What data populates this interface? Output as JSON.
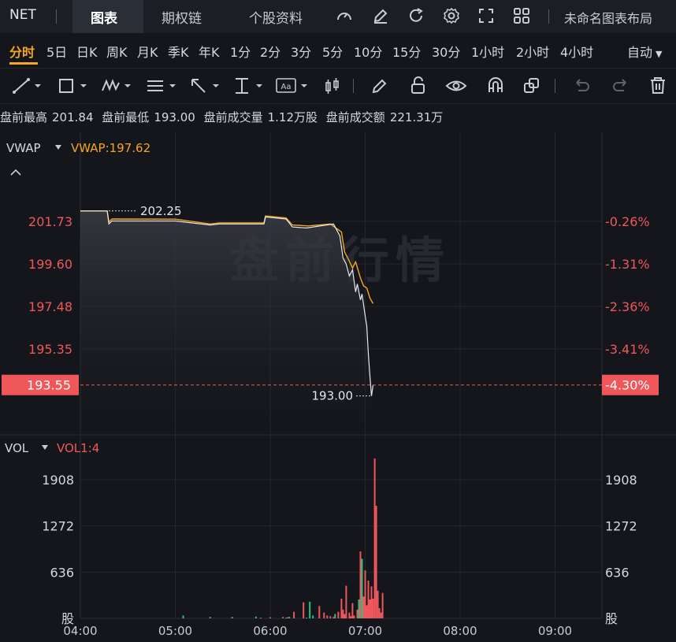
{
  "header": {
    "ticker": "NET",
    "tabs": [
      {
        "label": "图表",
        "active": true
      },
      {
        "label": "期权链",
        "active": false
      },
      {
        "label": "个股资料",
        "active": false
      }
    ],
    "icons": [
      "gauge-icon",
      "edit-icon",
      "refresh-icon",
      "gear-icon",
      "fullscreen-icon",
      "grid-icon"
    ],
    "layout_label": "未命名图表布局"
  },
  "periods": {
    "items": [
      "分时",
      "5日",
      "日K",
      "周K",
      "月K",
      "季K",
      "年K",
      "1分",
      "2分",
      "3分",
      "5分",
      "10分",
      "15分",
      "30分",
      "1小时",
      "2小时",
      "4小时"
    ],
    "active": "分时",
    "auto_label": "自动"
  },
  "toolbar": {
    "icons": [
      "line-tool-icon",
      "rect-tool-icon",
      "pattern-tool-icon",
      "fib-tool-icon",
      "arrow-tool-icon",
      "measure-tool-icon",
      "text-tool-icon",
      "candle-tool-icon",
      "pen-icon",
      "lock-icon",
      "eye-icon",
      "magnet-icon",
      "layers-icon",
      "undo-icon",
      "redo-icon",
      "trash-icon"
    ],
    "text_tool_label": "Aa"
  },
  "info": {
    "pre_high_label": "盘前最高",
    "pre_high": "201.84",
    "pre_low_label": "盘前最低",
    "pre_low": "193.00",
    "pre_vol_label": "盘前成交量",
    "pre_vol": "1.12万股",
    "pre_amt_label": "盘前成交额",
    "pre_amt": "221.31万"
  },
  "indicators": {
    "main_name": "VWAP",
    "main_value": "VWAP:197.62",
    "vol_name": "VOL",
    "vol_value": "VOL1:4"
  },
  "watermark": "盘前行情",
  "colors": {
    "price_line": "#e8e8e8",
    "vwap_line": "#f5a623",
    "up": "#2ebd85",
    "down": "#f0575b",
    "accent": "#f5a623",
    "current_tag": "#f0575b"
  },
  "chart_data": [
    {
      "type": "line",
      "title": "",
      "x_ticks": [
        "04:00",
        "05:00",
        "06:00",
        "07:00",
        "08:00",
        "09:00"
      ],
      "y_ticks_left": [
        "201.73",
        "199.60",
        "197.48",
        "195.35"
      ],
      "y_ticks_right": [
        "-0.26%",
        "-1.31%",
        "-2.36%",
        "-3.41%"
      ],
      "ylim": [
        192.5,
        203.0
      ],
      "current_price": "193.55",
      "current_pct": "-4.30%",
      "max_label": "202.25",
      "min_label": "193.00",
      "series": [
        {
          "name": "VWAP",
          "points": [
            [
              "04:00",
              202.25
            ],
            [
              "04:17",
              202.25
            ],
            [
              "04:18",
              201.7
            ],
            [
              "04:20",
              201.85
            ],
            [
              "05:00",
              201.84
            ],
            [
              "05:22",
              201.6
            ],
            [
              "05:28",
              201.65
            ],
            [
              "05:56",
              201.65
            ],
            [
              "05:57",
              202.0
            ],
            [
              "06:10",
              201.9
            ],
            [
              "06:14",
              201.55
            ],
            [
              "06:24",
              201.5
            ],
            [
              "06:38",
              201.6
            ],
            [
              "06:45",
              201.2
            ],
            [
              "06:47",
              200.2
            ],
            [
              "06:49",
              199.9
            ],
            [
              "06:52",
              199.4
            ],
            [
              "06:54",
              199.7
            ],
            [
              "06:57",
              198.9
            ],
            [
              "06:59",
              198.5
            ],
            [
              "07:01",
              198.4
            ],
            [
              "07:03",
              197.9
            ],
            [
              "07:05",
              197.62
            ]
          ]
        },
        {
          "name": "price",
          "points": [
            [
              "04:00",
              202.25
            ],
            [
              "04:17",
              202.25
            ],
            [
              "04:18",
              201.6
            ],
            [
              "04:20",
              201.75
            ],
            [
              "05:00",
              201.75
            ],
            [
              "05:22",
              201.55
            ],
            [
              "05:28",
              201.6
            ],
            [
              "05:56",
              201.6
            ],
            [
              "05:57",
              201.95
            ],
            [
              "06:10",
              201.85
            ],
            [
              "06:14",
              201.45
            ],
            [
              "06:23",
              201.4
            ],
            [
              "06:40",
              201.6
            ],
            [
              "06:44",
              201.0
            ],
            [
              "06:46",
              199.9
            ],
            [
              "06:48",
              199.6
            ],
            [
              "06:50",
              199.0
            ],
            [
              "06:52",
              199.3
            ],
            [
              "06:54",
              198.2
            ],
            [
              "06:55",
              198.6
            ],
            [
              "06:57",
              197.8
            ],
            [
              "06:58",
              198.1
            ],
            [
              "07:00",
              197.0
            ],
            [
              "07:01",
              196.5
            ],
            [
              "07:02",
              195.1
            ],
            [
              "07:03",
              194.0
            ],
            [
              "07:04",
              193.0
            ],
            [
              "07:05",
              193.55
            ]
          ]
        }
      ]
    },
    {
      "type": "bar",
      "title": "",
      "y_ticks": [
        "1908",
        "1272",
        "636"
      ],
      "y_unit_label": "股",
      "ylim": [
        0,
        2230
      ],
      "bars": [
        {
          "t": "05:05",
          "v": 40,
          "dir": "up"
        },
        {
          "t": "05:22",
          "v": 20,
          "dir": "up"
        },
        {
          "t": "05:36",
          "v": 20,
          "dir": "up"
        },
        {
          "t": "05:51",
          "v": 25,
          "dir": "up"
        },
        {
          "t": "05:54",
          "v": 10,
          "dir": "down"
        },
        {
          "t": "06:00",
          "v": 15,
          "dir": "down"
        },
        {
          "t": "06:08",
          "v": 20,
          "dir": "down"
        },
        {
          "t": "06:10",
          "v": 10,
          "dir": "up"
        },
        {
          "t": "06:11",
          "v": 15,
          "dir": "down"
        },
        {
          "t": "06:12",
          "v": 20,
          "dir": "up"
        },
        {
          "t": "06:15",
          "v": 90,
          "dir": "down"
        },
        {
          "t": "06:21",
          "v": 220,
          "dir": "down"
        },
        {
          "t": "06:23",
          "v": 10,
          "dir": "up"
        },
        {
          "t": "06:25",
          "v": 230,
          "dir": "up"
        },
        {
          "t": "06:27",
          "v": 40,
          "dir": "up"
        },
        {
          "t": "06:31",
          "v": 170,
          "dir": "down"
        },
        {
          "t": "06:34",
          "v": 80,
          "dir": "down"
        },
        {
          "t": "06:36",
          "v": 40,
          "dir": "down"
        },
        {
          "t": "06:38",
          "v": 30,
          "dir": "down"
        },
        {
          "t": "06:40",
          "v": 20,
          "dir": "down"
        },
        {
          "t": "06:41",
          "v": 60,
          "dir": "up"
        },
        {
          "t": "06:43",
          "v": 90,
          "dir": "down"
        },
        {
          "t": "06:45",
          "v": 270,
          "dir": "down"
        },
        {
          "t": "06:46",
          "v": 120,
          "dir": "down"
        },
        {
          "t": "06:47",
          "v": 60,
          "dir": "down"
        },
        {
          "t": "06:48",
          "v": 450,
          "dir": "down"
        },
        {
          "t": "06:50",
          "v": 80,
          "dir": "down"
        },
        {
          "t": "06:51",
          "v": 30,
          "dir": "down"
        },
        {
          "t": "06:52",
          "v": 210,
          "dir": "down"
        },
        {
          "t": "06:53",
          "v": 40,
          "dir": "down"
        },
        {
          "t": "06:55",
          "v": 120,
          "dir": "down"
        },
        {
          "t": "06:56",
          "v": 260,
          "dir": "up"
        },
        {
          "t": "06:57",
          "v": 920,
          "dir": "down"
        },
        {
          "t": "06:58",
          "v": 820,
          "dir": "up"
        },
        {
          "t": "06:59",
          "v": 300,
          "dir": "down"
        },
        {
          "t": "07:00",
          "v": 660,
          "dir": "down"
        },
        {
          "t": "07:01",
          "v": 180,
          "dir": "down"
        },
        {
          "t": "07:02",
          "v": 520,
          "dir": "down"
        },
        {
          "t": "07:03",
          "v": 260,
          "dir": "down"
        },
        {
          "t": "07:04",
          "v": 440,
          "dir": "down"
        },
        {
          "t": "07:05",
          "v": 270,
          "dir": "down"
        },
        {
          "t": "07:06",
          "v": 2200,
          "dir": "down"
        },
        {
          "t": "07:07",
          "v": 1550,
          "dir": "down"
        },
        {
          "t": "07:08",
          "v": 380,
          "dir": "down"
        },
        {
          "t": "07:09",
          "v": 140,
          "dir": "down"
        },
        {
          "t": "07:10",
          "v": 80,
          "dir": "down"
        },
        {
          "t": "07:11",
          "v": 350,
          "dir": "down"
        }
      ]
    }
  ]
}
